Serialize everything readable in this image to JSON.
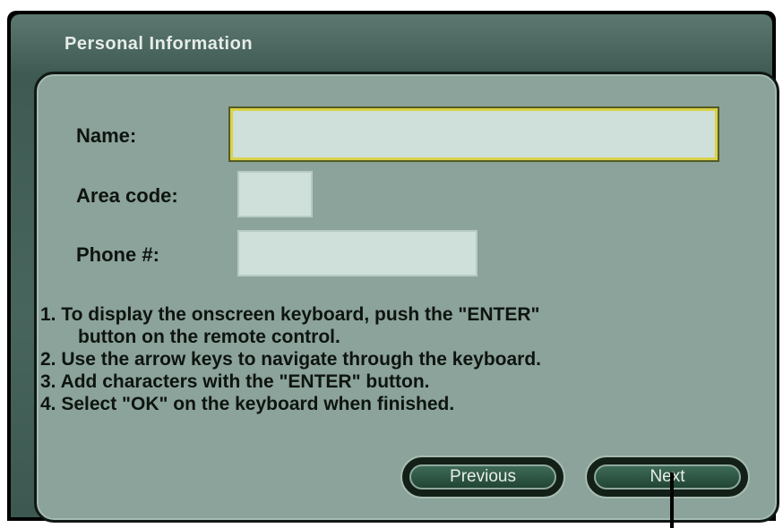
{
  "dialog": {
    "title": "Personal Information"
  },
  "form": {
    "name_label": "Name:",
    "name_value": "",
    "area_code_label": "Area code:",
    "area_code_value": "",
    "phone_label": "Phone #:",
    "phone_value": ""
  },
  "instructions": [
    "1. To display the onscreen keyboard, push the \"ENTER\"",
    "button on the remote control.",
    "2. Use the arrow keys to navigate through the keyboard.",
    "3. Add characters with the \"ENTER\" button.",
    "4. Select \"OK\" on the keyboard when finished."
  ],
  "buttons": {
    "previous": "Previous",
    "next": "Next"
  },
  "colors": {
    "panel": "#8ba39a",
    "frame": "#48655d",
    "input": "#cfdfda",
    "focus": "#d8d24a",
    "button": "#224535"
  }
}
